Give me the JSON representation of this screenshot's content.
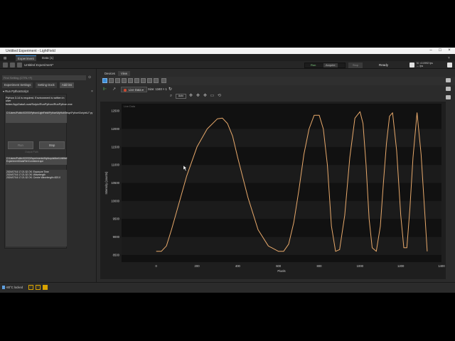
{
  "window": {
    "title": "Untitled Experiment - LightField",
    "min": "–",
    "max": "□",
    "close": "×"
  },
  "top_tabs": [
    {
      "label": "Experiment"
    },
    {
      "label": "Data (1)"
    }
  ],
  "toolbar": {
    "experiment_name": "Untitled Experiment*",
    "run_label": "Run",
    "acquire_label": "Acquire",
    "stop_label": "Stop",
    "status": "Ready",
    "fps_line1": "N: <0.0992 fps",
    "fps_line2": "--- fps"
  },
  "left_panel": {
    "search_placeholder": "Find Setting (CTRL+F)",
    "tabs": [
      {
        "label": "Experiment Settings"
      },
      {
        "label": "Setting Dock"
      },
      {
        "label": "Add-ins"
      }
    ],
    "addin_title": "Run PythonScript",
    "message": "Python 3.14 is required. Environment is written in user folder/AppData/Local/Sulpiz/RunPython/RunPython.exe",
    "script_path": "C:\\Users\\Public\\SOSS\\Python\\LightField\\Python\\MyHubSetup\\Python\\Scripts\\LF.py",
    "run_button": "Run",
    "stop_button": "Stop",
    "output_label": "Output Path",
    "data_path": "C:\\Users\\Public\\SOSS\\Experiments\\MyAcquisition\\Untitled Experiment\\DataFile\\Combined.spe",
    "log_lines": [
      "2024/07/16 17:21:32 OK: Exposure Time",
      "2024/07/16 17:21:32 OK: Wavelength",
      "2024/07/16 17:21:32 OK: Centre Wavelength=820.0"
    ]
  },
  "right_panel": {
    "tabs": [
      {
        "label": "Devices"
      },
      {
        "label": "View"
      }
    ],
    "live_label": "Live Data",
    "size_label": "Size: 1340 × 1",
    "zoom_label": "Auto"
  },
  "chart_data": {
    "type": "line",
    "title": "",
    "legend": "Live Data",
    "xlabel": "Pixels",
    "ylabel": "Intensity (counts)",
    "xlim": [
      -170,
      1400
    ],
    "ylim": [
      8300,
      12700
    ],
    "xticks": [
      0,
      200,
      400,
      600,
      800,
      1000,
      1200,
      1400
    ],
    "yticks": [
      8500,
      9000,
      9500,
      10000,
      10500,
      11000,
      11500,
      12000,
      12500
    ],
    "grid": "horizontal bands",
    "line_color": "#e8a96b",
    "series": [
      {
        "x": [
          0,
          25,
          50,
          75,
          100,
          150,
          200,
          250,
          300,
          325,
          350,
          375,
          400,
          450,
          500,
          550,
          600,
          625,
          650,
          675,
          700,
          725,
          750,
          775,
          800,
          820,
          840,
          860,
          880,
          900,
          925,
          950,
          975,
          1000,
          1015,
          1030,
          1045,
          1060,
          1080,
          1100,
          1115,
          1130,
          1145,
          1160,
          1180,
          1200,
          1215,
          1230,
          1245,
          1260,
          1280,
          1300,
          1330
        ],
        "y": [
          8600,
          8600,
          8750,
          9200,
          9700,
          10700,
          11500,
          12000,
          12280,
          12300,
          12150,
          11800,
          11200,
          10100,
          9200,
          8750,
          8600,
          8600,
          8800,
          9400,
          10300,
          11300,
          12000,
          12380,
          12380,
          12000,
          11000,
          9300,
          8600,
          8650,
          9600,
          11200,
          12300,
          12480,
          12150,
          11000,
          9500,
          8700,
          8600,
          9300,
          10500,
          11600,
          12350,
          12450,
          11400,
          9600,
          8700,
          8700,
          9800,
          11200,
          12450,
          11300,
          8600
        ]
      }
    ]
  },
  "statusbar": {
    "temperature": "-80°C locked"
  }
}
